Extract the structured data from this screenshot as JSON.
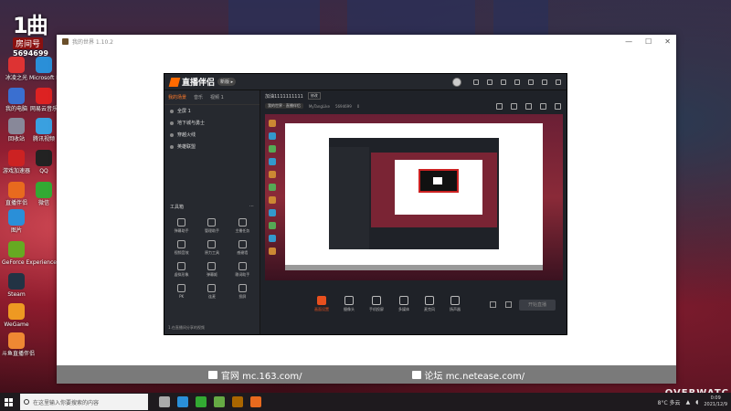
{
  "overlay": {
    "logo": "1曲",
    "pill": "房间号",
    "room_id": "5694699"
  },
  "desktop_icons": [
    {
      "label": "冰凌之光",
      "color": "#d33"
    },
    {
      "label": "Microsoft Edge",
      "color": "#2a8fd8"
    },
    {
      "label": "我的电脑",
      "color": "#3a6fd0"
    },
    {
      "label": "网易云音乐",
      "color": "#d22"
    },
    {
      "label": "回收站",
      "color": "#889"
    },
    {
      "label": "腾讯视频",
      "color": "#3aa0e0"
    },
    {
      "label": "游戏加速器",
      "color": "#c22"
    },
    {
      "label": "QQ",
      "color": "#222"
    },
    {
      "label": "直播伴侣",
      "color": "#e86a1e"
    },
    {
      "label": "微信",
      "color": "#3a3"
    },
    {
      "label": "图片",
      "color": "#2a8fd8"
    },
    {
      "label": "GeForce Experience",
      "color": "#6a2"
    },
    {
      "label": "Steam",
      "color": "#234"
    },
    {
      "label": "WeGame",
      "color": "#e92"
    },
    {
      "label": "斗鱼直播伴侣",
      "color": "#e83"
    }
  ],
  "app_window": {
    "title": "我的世界 1.10.2",
    "controls": [
      "—",
      "☐",
      "✕"
    ],
    "footer": [
      {
        "icon": "home-icon",
        "text": "官网 mc.163.com/"
      },
      {
        "icon": "forum-icon",
        "text": "论坛 mc.netease.com/"
      }
    ]
  },
  "stream_app": {
    "logo": "直播伴侣",
    "version": "新版 ▸",
    "tabs": [
      "我的场景",
      "音乐",
      "视频 1"
    ],
    "scenes": [
      "全屏 1",
      "地下城与勇士",
      "穿越火线",
      "英雄联盟"
    ],
    "tools_title": "工具箱",
    "tools": [
      "弹幕助手",
      "管理助手",
      "主播任务",
      "视频音效",
      "原力工具",
      "感谢墙",
      "虚拟形象",
      "弹幕姬",
      "歌词助手",
      "PK",
      "连麦",
      "投屏"
    ],
    "footer_note": "1.在直播间分享的视频",
    "room_title": "加油1111111111",
    "edit_tag": "修改",
    "category": "我的世界 · 直播伴侣",
    "username": "MyTangLike",
    "room_no": "5694699",
    "heat": "0",
    "controls": [
      {
        "label": "画面设置",
        "active": true
      },
      {
        "label": "摄像头",
        "active": false
      },
      {
        "label": "手机投屏",
        "active": false
      },
      {
        "label": "多媒体",
        "active": false
      },
      {
        "label": "麦克风",
        "active": false
      },
      {
        "label": "扬声器",
        "active": false
      }
    ],
    "go_live": "开始直播"
  },
  "taskbar": {
    "search_placeholder": "在这里输入你要搜索的内容",
    "apps": [
      {
        "name": "task-view",
        "color": "#aaa"
      },
      {
        "name": "edge",
        "color": "#2a8fd8"
      },
      {
        "name": "wechat",
        "color": "#3a3"
      },
      {
        "name": "minecraft",
        "color": "#6a4"
      },
      {
        "name": "obs",
        "color": "#a60"
      },
      {
        "name": "stream",
        "color": "#e86a1e"
      }
    ],
    "weather": "8°C 多云",
    "time": "0:09",
    "date": "2021/12/9"
  },
  "overwatch_text": "OVERWATC"
}
